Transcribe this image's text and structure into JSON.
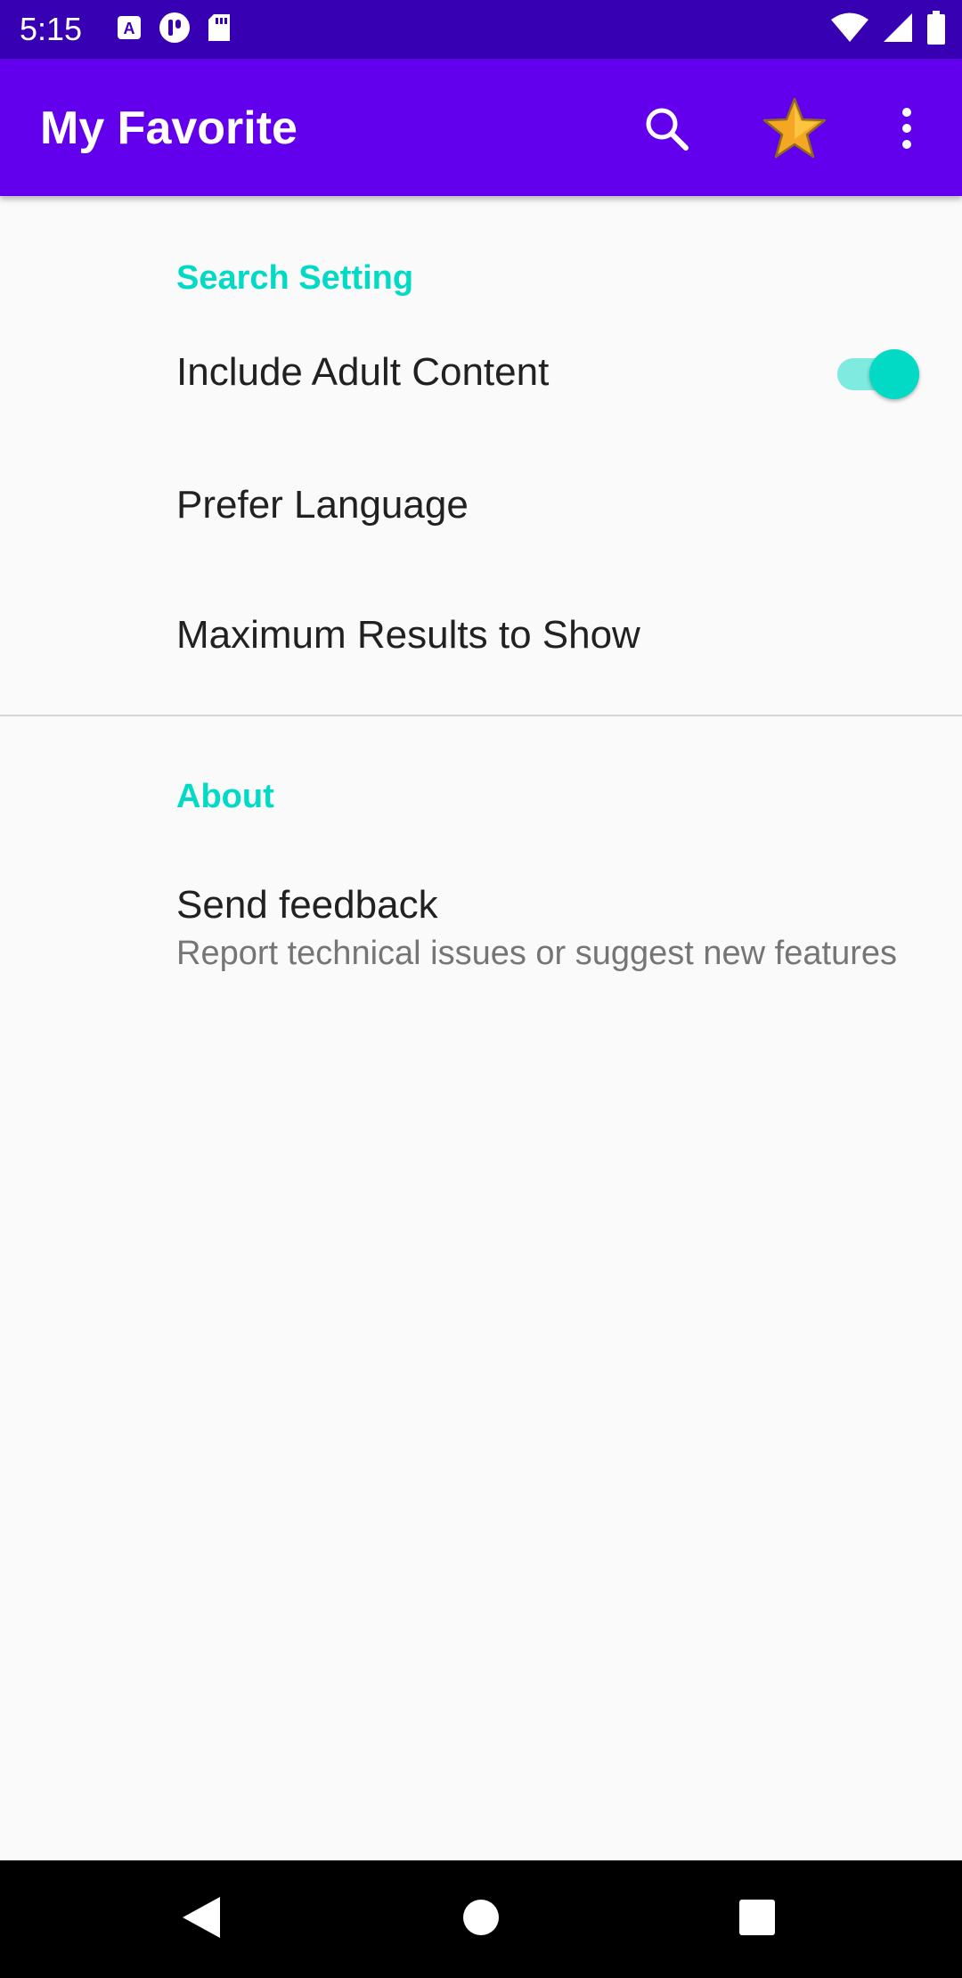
{
  "status_bar": {
    "time": "5:15",
    "left_icons": [
      "a-notification-icon",
      "circle-notification-icon",
      "sd-card-icon"
    ],
    "right_icons": [
      "wifi-icon",
      "signal-icon",
      "battery-icon"
    ]
  },
  "app_bar": {
    "title": "My Favorite",
    "actions": [
      "search-icon",
      "star-icon",
      "overflow-menu-icon"
    ],
    "color": "#6200ee",
    "status_color": "#3700b3"
  },
  "sections": {
    "search": {
      "header": "Search Setting",
      "adult_content": {
        "title": "Include Adult Content",
        "enabled": true
      },
      "prefer_language": {
        "title": "Prefer Language"
      },
      "max_results": {
        "title": "Maximum Results to Show"
      }
    },
    "about": {
      "header": "About",
      "feedback": {
        "title": "Send feedback",
        "summary": "Report technical issues or suggest new features"
      }
    }
  },
  "accent_color": "#03dac5",
  "nav_bar": {
    "buttons": [
      "back-icon",
      "home-icon",
      "recents-icon"
    ]
  }
}
